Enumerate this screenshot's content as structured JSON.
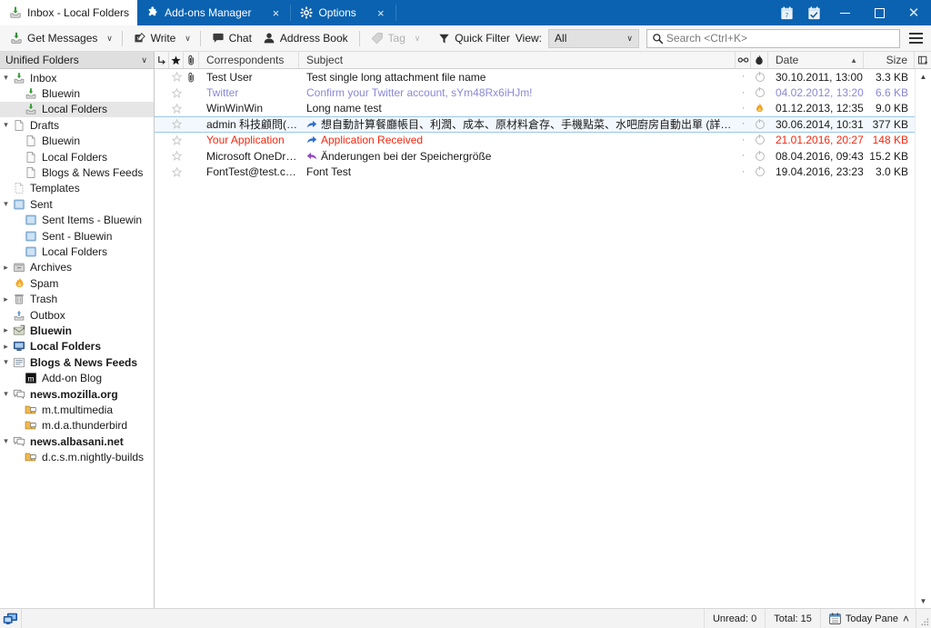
{
  "window": {
    "tabs": [
      {
        "label": "Inbox - Local Folders",
        "icon": "inbox-icon",
        "active": true,
        "closable": false
      },
      {
        "label": "Add-ons Manager",
        "icon": "addons-puzzle-icon",
        "active": false,
        "closable": true
      },
      {
        "label": "Options",
        "icon": "gear-icon",
        "active": false,
        "closable": true
      }
    ],
    "close_label": "×",
    "system_icons": [
      "calendar-icon",
      "tasks-icon"
    ],
    "controls": {
      "minimize": "–",
      "maximize": "□",
      "close": "✕"
    },
    "titlebar_color": "#0a62b0"
  },
  "toolbar": {
    "get_messages_label": "Get Messages",
    "write_label": "Write",
    "chat_label": "Chat",
    "address_book_label": "Address Book",
    "tag_label": "Tag",
    "quick_filter_label": "Quick Filter",
    "view_label": "View:",
    "view_value": "All",
    "search_placeholder": "Search <Ctrl+K>",
    "caret": "∨"
  },
  "sidebar": {
    "header": "Unified Folders",
    "header_caret": "∨",
    "items": [
      {
        "label": "Inbox",
        "indent": 0,
        "twisty": "open",
        "icon": "inbox-icon",
        "bold": false,
        "selected": false
      },
      {
        "label": "Bluewin",
        "indent": 1,
        "twisty": "none",
        "icon": "inbox-icon",
        "bold": false,
        "selected": false
      },
      {
        "label": "Local Folders",
        "indent": 1,
        "twisty": "none",
        "icon": "inbox-icon",
        "bold": false,
        "selected": true
      },
      {
        "label": "Drafts",
        "indent": 0,
        "twisty": "open",
        "icon": "draft-icon",
        "bold": false,
        "selected": false
      },
      {
        "label": "Bluewin",
        "indent": 1,
        "twisty": "none",
        "icon": "draft-icon",
        "bold": false,
        "selected": false
      },
      {
        "label": "Local Folders",
        "indent": 1,
        "twisty": "none",
        "icon": "draft-icon",
        "bold": false,
        "selected": false
      },
      {
        "label": "Blogs & News Feeds",
        "indent": 1,
        "twisty": "none",
        "icon": "draft-icon",
        "bold": false,
        "selected": false
      },
      {
        "label": "Templates",
        "indent": 0,
        "twisty": "none",
        "icon": "template-icon",
        "bold": false,
        "selected": false
      },
      {
        "label": "Sent",
        "indent": 0,
        "twisty": "open",
        "icon": "sent-icon",
        "bold": false,
        "selected": false
      },
      {
        "label": "Sent Items - Bluewin",
        "indent": 1,
        "twisty": "none",
        "icon": "sent-icon",
        "bold": false,
        "selected": false
      },
      {
        "label": "Sent - Bluewin",
        "indent": 1,
        "twisty": "none",
        "icon": "sent-icon",
        "bold": false,
        "selected": false
      },
      {
        "label": "Local Folders",
        "indent": 1,
        "twisty": "none",
        "icon": "sent-icon",
        "bold": false,
        "selected": false
      },
      {
        "label": "Archives",
        "indent": 0,
        "twisty": "closed",
        "icon": "archive-icon",
        "bold": false,
        "selected": false
      },
      {
        "label": "Spam",
        "indent": 0,
        "twisty": "none",
        "icon": "spam-flame-icon",
        "bold": false,
        "selected": false
      },
      {
        "label": "Trash",
        "indent": 0,
        "twisty": "closed",
        "icon": "trash-icon",
        "bold": false,
        "selected": false
      },
      {
        "label": "Outbox",
        "indent": 0,
        "twisty": "none",
        "icon": "outbox-icon",
        "bold": false,
        "selected": false
      },
      {
        "label": "Bluewin",
        "indent": 0,
        "twisty": "closed",
        "icon": "account-icon",
        "bold": true,
        "selected": false
      },
      {
        "label": "Local Folders",
        "indent": 0,
        "twisty": "closed",
        "icon": "localfolders-icon",
        "bold": true,
        "selected": false
      },
      {
        "label": "Blogs & News Feeds",
        "indent": 0,
        "twisty": "open",
        "icon": "feeds-icon",
        "bold": true,
        "selected": false
      },
      {
        "label": "Add-on Blog",
        "indent": 1,
        "twisty": "none",
        "icon": "mozilla-m-icon",
        "bold": false,
        "selected": false
      },
      {
        "label": "news.mozilla.org",
        "indent": 0,
        "twisty": "open",
        "icon": "newsgroup-icon",
        "bold": true,
        "selected": false
      },
      {
        "label": "m.t.multimedia",
        "indent": 1,
        "twisty": "none",
        "icon": "newsfolder-icon",
        "bold": false,
        "selected": false
      },
      {
        "label": "m.d.a.thunderbird",
        "indent": 1,
        "twisty": "none",
        "icon": "newsfolder-icon",
        "bold": false,
        "selected": false
      },
      {
        "label": "news.albasani.net",
        "indent": 0,
        "twisty": "open",
        "icon": "newsgroup-icon",
        "bold": true,
        "selected": false
      },
      {
        "label": "d.c.s.m.nightly-builds",
        "indent": 1,
        "twisty": "none",
        "icon": "newsfolder-icon",
        "bold": false,
        "selected": false
      }
    ]
  },
  "messagelist": {
    "columns": {
      "thread": "thread-icon",
      "star": "star-icon",
      "attachment": "paperclip-icon",
      "correspondents": "Correspondents",
      "subject": "Subject",
      "unread": "unread-icon",
      "junk": "junk-icon",
      "date": "Date",
      "size": "Size",
      "picker": "column-picker-icon"
    },
    "sort": {
      "column": "Date",
      "direction": "asc",
      "glyph": "▲"
    },
    "rows": [
      {
        "correspondent": "Test User",
        "subject": "Test single long attachment file name",
        "date": "30.10.2011, 13:00",
        "size": "3.3 KB",
        "color": "#1a1a1a",
        "attachment": true,
        "thread_marker": "none",
        "junk": "read-dot",
        "selected": false
      },
      {
        "correspondent": "Twitter",
        "subject": "Confirm your Twitter account, sYm48Rx6iHJm!",
        "date": "04.02.2012, 13:20",
        "size": "6.6 KB",
        "color": "#8a87d8",
        "attachment": false,
        "thread_marker": "none",
        "junk": "read-dot",
        "selected": false
      },
      {
        "correspondent": "WinWinWin",
        "subject": "Long name test",
        "date": "01.12.2013, 12:35",
        "size": "9.0 KB",
        "color": "#1a1a1a",
        "attachment": false,
        "thread_marker": "none",
        "junk": "spam-flame",
        "selected": false
      },
      {
        "correspondent": "admin 科技顧問(香...",
        "subject": "想自動計算餐廳帳目、利潤、成本、原材料倉存、手機點菜、水吧廚房自動出單 (詳細資料...)",
        "date": "30.06.2014, 10:31",
        "size": "377 KB",
        "color": "#1a1a1a",
        "attachment": false,
        "thread_marker": "forwarded",
        "junk": "read-dot",
        "selected": true
      },
      {
        "correspondent": "Your Application",
        "subject": "Application Received",
        "date": "21.01.2016, 20:27",
        "size": "148 KB",
        "color": "#f2280f",
        "attachment": false,
        "thread_marker": "forwarded",
        "junk": "read-dot",
        "selected": false
      },
      {
        "correspondent": "Microsoft OneDrive",
        "subject": "Änderungen bei der Speichergröße",
        "date": "08.04.2016, 09:43",
        "size": "15.2 KB",
        "color": "#1a1a1a",
        "attachment": false,
        "thread_marker": "replied",
        "junk": "read-dot",
        "selected": false
      },
      {
        "correspondent": "FontTest@test.com",
        "subject": "Font Test",
        "date": "19.04.2016, 23:23",
        "size": "3.0 KB",
        "color": "#1a1a1a",
        "attachment": false,
        "thread_marker": "none",
        "junk": "read-dot",
        "selected": false
      }
    ]
  },
  "statusbar": {
    "unread": "Unread: 0",
    "total": "Total: 15",
    "today_pane": "Today Pane",
    "today_caret": "˄",
    "connection_icon": "network-icon"
  }
}
